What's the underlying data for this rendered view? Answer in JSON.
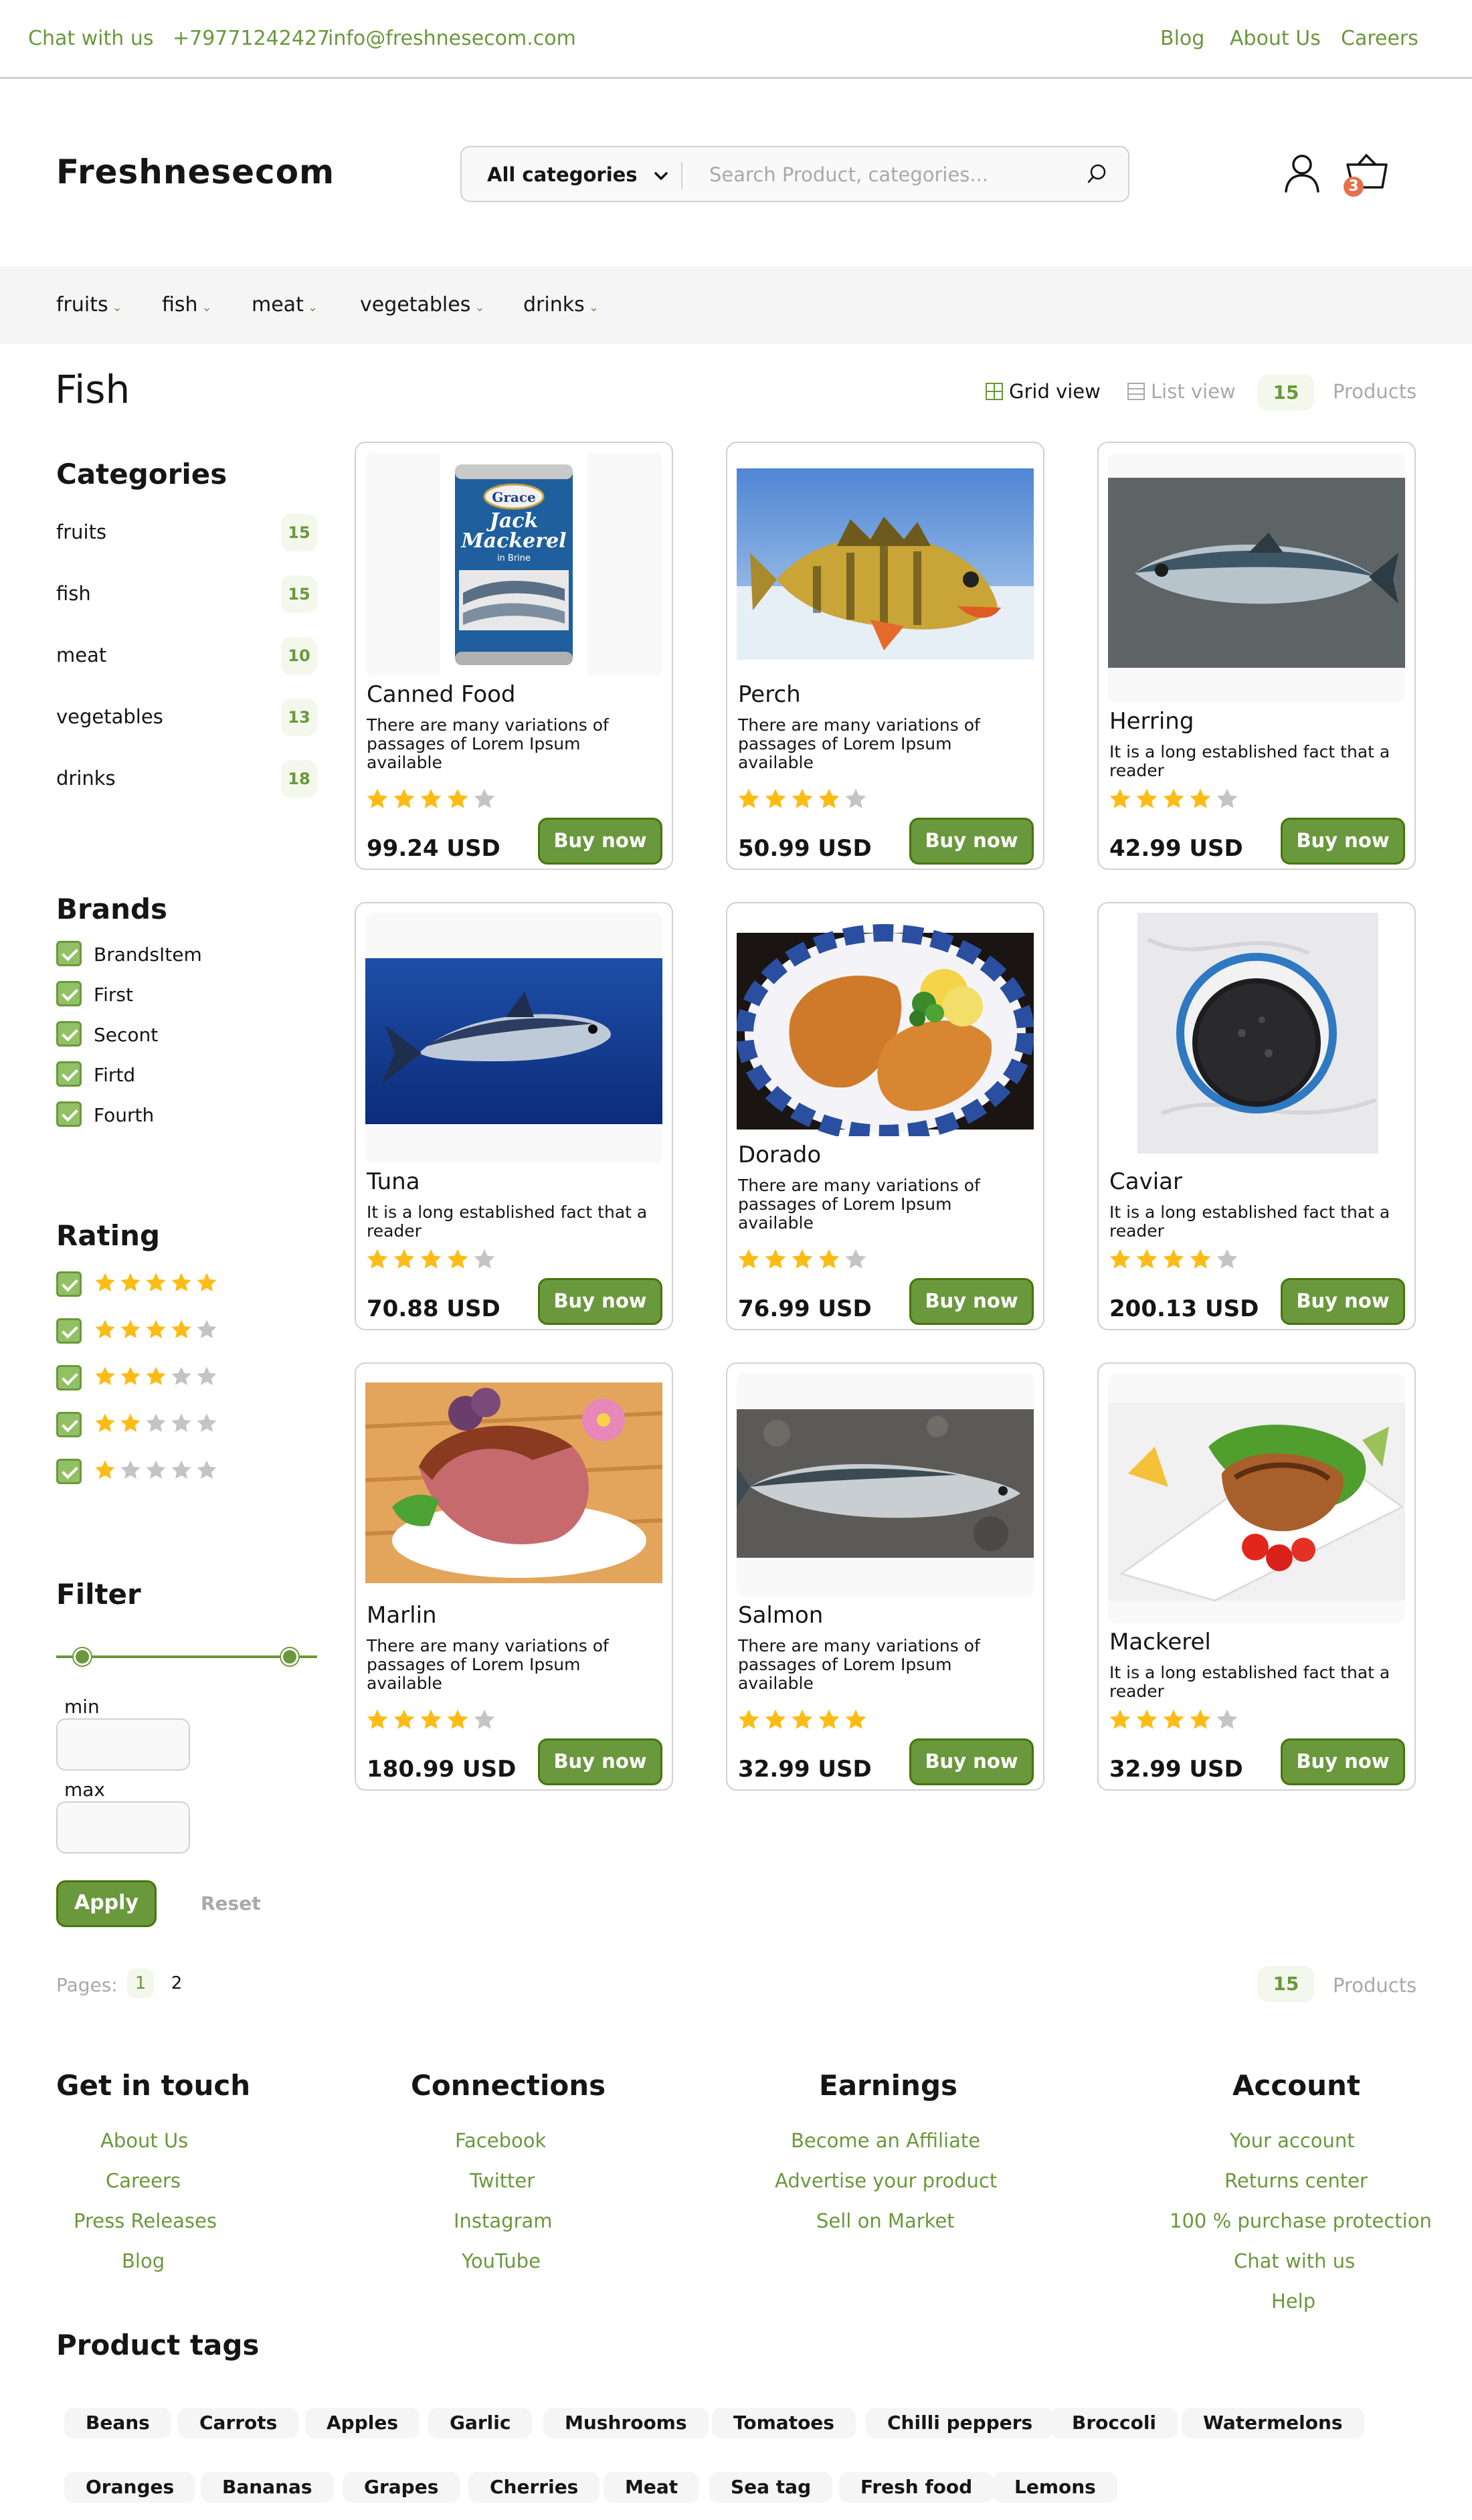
{
  "topbar": {
    "chat": "Chat with us",
    "phone": "+79771242427",
    "email": "info@freshnesecom.com",
    "links": [
      "Blog",
      "About Us",
      "Careers"
    ]
  },
  "header": {
    "logo": "Freshnesecom",
    "search_category": "All categories",
    "search_placeholder": "Search Product, categories...",
    "cart_count": "3"
  },
  "nav": {
    "items": [
      "fruits",
      "fish",
      "meat",
      "vegetables",
      "drinks"
    ]
  },
  "page": {
    "title": "Fish",
    "grid_view": "Grid view",
    "list_view": "List view",
    "product_count": "15",
    "products_label": "Products"
  },
  "sidebar": {
    "categories_title": "Categories",
    "categories": [
      {
        "label": "fruits",
        "count": "15"
      },
      {
        "label": "fish",
        "count": "15"
      },
      {
        "label": "meat",
        "count": "10"
      },
      {
        "label": "vegetables",
        "count": "13"
      },
      {
        "label": "drinks",
        "count": "18"
      }
    ],
    "brands_title": "Brands",
    "brands": [
      "BrandsItem",
      "First",
      "Secont",
      "Firtd",
      "Fourth"
    ],
    "rating_title": "Rating",
    "ratings": [
      5,
      4,
      3,
      2,
      1
    ],
    "filter_title": "Filter",
    "min_label": "min",
    "max_label": "max",
    "apply": "Apply",
    "reset": "Reset"
  },
  "products": [
    {
      "name": "Canned Food",
      "desc": "There are many variations of passages of Lorem Ipsum available",
      "rating": 4,
      "price": "99.24 USD",
      "buy": "Buy now",
      "image": "canned-mackerel",
      "can_brand": "Grace",
      "can_title": "Jack Mackerel",
      "can_sub": "in Brine"
    },
    {
      "name": "Perch",
      "desc": "There are many variations of passages of Lorem Ipsum available",
      "rating": 4,
      "price": "50.99 USD",
      "buy": "Buy now",
      "image": "perch-fish"
    },
    {
      "name": "Herring",
      "desc": "It is a long established fact that a reader",
      "rating": 4,
      "price": "42.99 USD",
      "buy": "Buy now",
      "image": "herring-fish"
    },
    {
      "name": "Tuna",
      "desc": "It is a long established fact that a reader",
      "rating": 4,
      "price": "70.88 USD",
      "buy": "Buy now",
      "image": "tuna-fish"
    },
    {
      "name": "Dorado",
      "desc": "There are many variations of passages of Lorem Ipsum available",
      "rating": 4,
      "price": "76.99 USD",
      "buy": "Buy now",
      "image": "fried-fish-plate"
    },
    {
      "name": "Caviar",
      "desc": "It is a long established fact that a reader",
      "rating": 4,
      "price": "200.13 USD",
      "buy": "Buy now",
      "image": "caviar-tin"
    },
    {
      "name": "Marlin",
      "desc": "There are many variations of passages of Lorem Ipsum available",
      "rating": 4,
      "price": "180.99 USD",
      "buy": "Buy now",
      "image": "marlin-ham"
    },
    {
      "name": "Salmon",
      "desc": "There are many variations of passages of Lorem Ipsum available",
      "rating": 5,
      "price": "32.99 USD",
      "buy": "Buy now",
      "image": "salmon-fish"
    },
    {
      "name": "Mackerel",
      "desc": "It is a long established fact that a reader",
      "rating": 4,
      "price": "32.99 USD",
      "buy": "Buy now",
      "image": "mackerel-salad"
    }
  ],
  "pagination": {
    "label": "Pages:",
    "pages": [
      "1",
      "2"
    ],
    "product_count": "15",
    "products_label": "Products"
  },
  "footer": {
    "columns": [
      {
        "title": "Get in touch",
        "links": [
          "About Us",
          "Careers",
          "Press Releases",
          "Blog"
        ]
      },
      {
        "title": "Connections",
        "links": [
          "Facebook",
          "Twitter",
          "Instagram",
          "YouTube"
        ]
      },
      {
        "title": "Earnings",
        "links": [
          "Become an Affiliate",
          "Advertise your product",
          "Sell on Market"
        ]
      },
      {
        "title": "Account",
        "links": [
          "Your account",
          "Returns center",
          "100 % purchase protection",
          "Chat with us",
          "Help"
        ]
      }
    ],
    "tags_title": "Product tags",
    "tags_row1": [
      "Beans",
      "Carrots",
      "Apples",
      "Garlic",
      "Mushrooms",
      "Tomatoes",
      "Chilli peppers",
      "Broccoli",
      "Watermelons"
    ],
    "tags_row2": [
      "Oranges",
      "Bananas",
      "Grapes",
      "Cherries",
      "Meat",
      "Sea tag",
      "Fresh food",
      "Lemons"
    ]
  },
  "colors": {
    "accent": "#6a983c",
    "accent_dark": "#46760a",
    "star": "#fdbc15",
    "star_empty": "#c4c4c4",
    "badge_bg": "#f4f8ec",
    "cart_badge": "#e5704b"
  }
}
